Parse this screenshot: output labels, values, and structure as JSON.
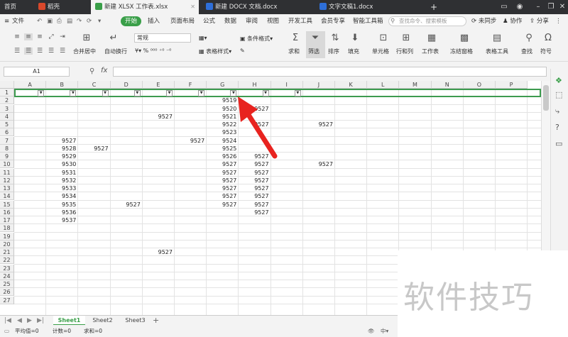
{
  "tabs": {
    "home": "首页",
    "wps": "稻壳",
    "xlsx": "新建 XLSX 工作表.xlsx",
    "docx": "新建 DOCX 文档.docx",
    "doc1": "文字文稿1.docx",
    "plus": "+"
  },
  "menu": {
    "file": "文件",
    "start": "开始",
    "insert": "插入",
    "layout": "页面布局",
    "formula": "公式",
    "data": "数据",
    "review": "审阅",
    "view": "视图",
    "dev": "开发工具",
    "member": "会员专享",
    "smart": "智能工具箱",
    "search_placeholder": "查找命令、搜索模板",
    "sync": "未同步",
    "collab": "协作",
    "share": "分享"
  },
  "ribbon": {
    "merge": "合并居中",
    "wrap": "自动换行",
    "font": "常规",
    "currency": "¥",
    "percent": "%",
    "cond": "条件格式",
    "cellstyle": "表格样式",
    "sum": "求和",
    "filter": "筛选",
    "sort": "排序",
    "fill": "填充",
    "cell": "单元格",
    "rowcol": "行和列",
    "sheet": "工作表",
    "freeze": "冻结窗格",
    "tabletools": "表格工具",
    "find": "查找",
    "symbol": "符号"
  },
  "formula": {
    "cellref": "A1",
    "fx": "fx"
  },
  "columns": [
    "A",
    "B",
    "C",
    "D",
    "E",
    "F",
    "G",
    "H",
    "I",
    "J",
    "K",
    "L",
    "M",
    "N",
    "O",
    "P"
  ],
  "rows": [
    "1",
    "2",
    "3",
    "4",
    "5",
    "6",
    "7",
    "8",
    "9",
    "10",
    "11",
    "12",
    "13",
    "14",
    "15",
    "16",
    "17",
    "18",
    "19",
    "20",
    "21",
    "22",
    "23",
    "24",
    "25",
    "26",
    "27"
  ],
  "cells": [
    {
      "r": 2,
      "c": "G",
      "v": "9519"
    },
    {
      "r": 3,
      "c": "G",
      "v": "9520"
    },
    {
      "r": 3,
      "c": "H",
      "v": "9527"
    },
    {
      "r": 4,
      "c": "E",
      "v": "9527"
    },
    {
      "r": 4,
      "c": "G",
      "v": "9521"
    },
    {
      "r": 5,
      "c": "G",
      "v": "9522"
    },
    {
      "r": 5,
      "c": "H",
      "v": "9527"
    },
    {
      "r": 5,
      "c": "J",
      "v": "9527"
    },
    {
      "r": 6,
      "c": "G",
      "v": "9523"
    },
    {
      "r": 7,
      "c": "B",
      "v": "9527"
    },
    {
      "r": 7,
      "c": "F",
      "v": "9527"
    },
    {
      "r": 7,
      "c": "G",
      "v": "9524"
    },
    {
      "r": 8,
      "c": "B",
      "v": "9528"
    },
    {
      "r": 8,
      "c": "C",
      "v": "9527"
    },
    {
      "r": 8,
      "c": "G",
      "v": "9525"
    },
    {
      "r": 9,
      "c": "B",
      "v": "9529"
    },
    {
      "r": 9,
      "c": "G",
      "v": "9526"
    },
    {
      "r": 9,
      "c": "H",
      "v": "9527"
    },
    {
      "r": 10,
      "c": "B",
      "v": "9530"
    },
    {
      "r": 10,
      "c": "G",
      "v": "9527"
    },
    {
      "r": 10,
      "c": "H",
      "v": "9527"
    },
    {
      "r": 10,
      "c": "J",
      "v": "9527"
    },
    {
      "r": 11,
      "c": "B",
      "v": "9531"
    },
    {
      "r": 11,
      "c": "G",
      "v": "9527"
    },
    {
      "r": 11,
      "c": "H",
      "v": "9527"
    },
    {
      "r": 12,
      "c": "B",
      "v": "9532"
    },
    {
      "r": 12,
      "c": "G",
      "v": "9527"
    },
    {
      "r": 12,
      "c": "H",
      "v": "9527"
    },
    {
      "r": 13,
      "c": "B",
      "v": "9533"
    },
    {
      "r": 13,
      "c": "G",
      "v": "9527"
    },
    {
      "r": 13,
      "c": "H",
      "v": "9527"
    },
    {
      "r": 14,
      "c": "B",
      "v": "9534"
    },
    {
      "r": 14,
      "c": "G",
      "v": "9527"
    },
    {
      "r": 14,
      "c": "H",
      "v": "9527"
    },
    {
      "r": 15,
      "c": "B",
      "v": "9535"
    },
    {
      "r": 15,
      "c": "D",
      "v": "9527"
    },
    {
      "r": 15,
      "c": "G",
      "v": "9527"
    },
    {
      "r": 15,
      "c": "H",
      "v": "9527"
    },
    {
      "r": 16,
      "c": "B",
      "v": "9536"
    },
    {
      "r": 16,
      "c": "H",
      "v": "9527"
    },
    {
      "r": 17,
      "c": "B",
      "v": "9537"
    },
    {
      "r": 21,
      "c": "E",
      "v": "9527"
    }
  ],
  "sheets": [
    "Sheet1",
    "Sheet2",
    "Sheet3"
  ],
  "status": {
    "avg": "平均值=0",
    "count": "计数=0",
    "sum": "求和=0"
  },
  "watermark": "软件技巧",
  "colors": {
    "accent": "#3a9f49",
    "arrow": "#e8231f"
  }
}
